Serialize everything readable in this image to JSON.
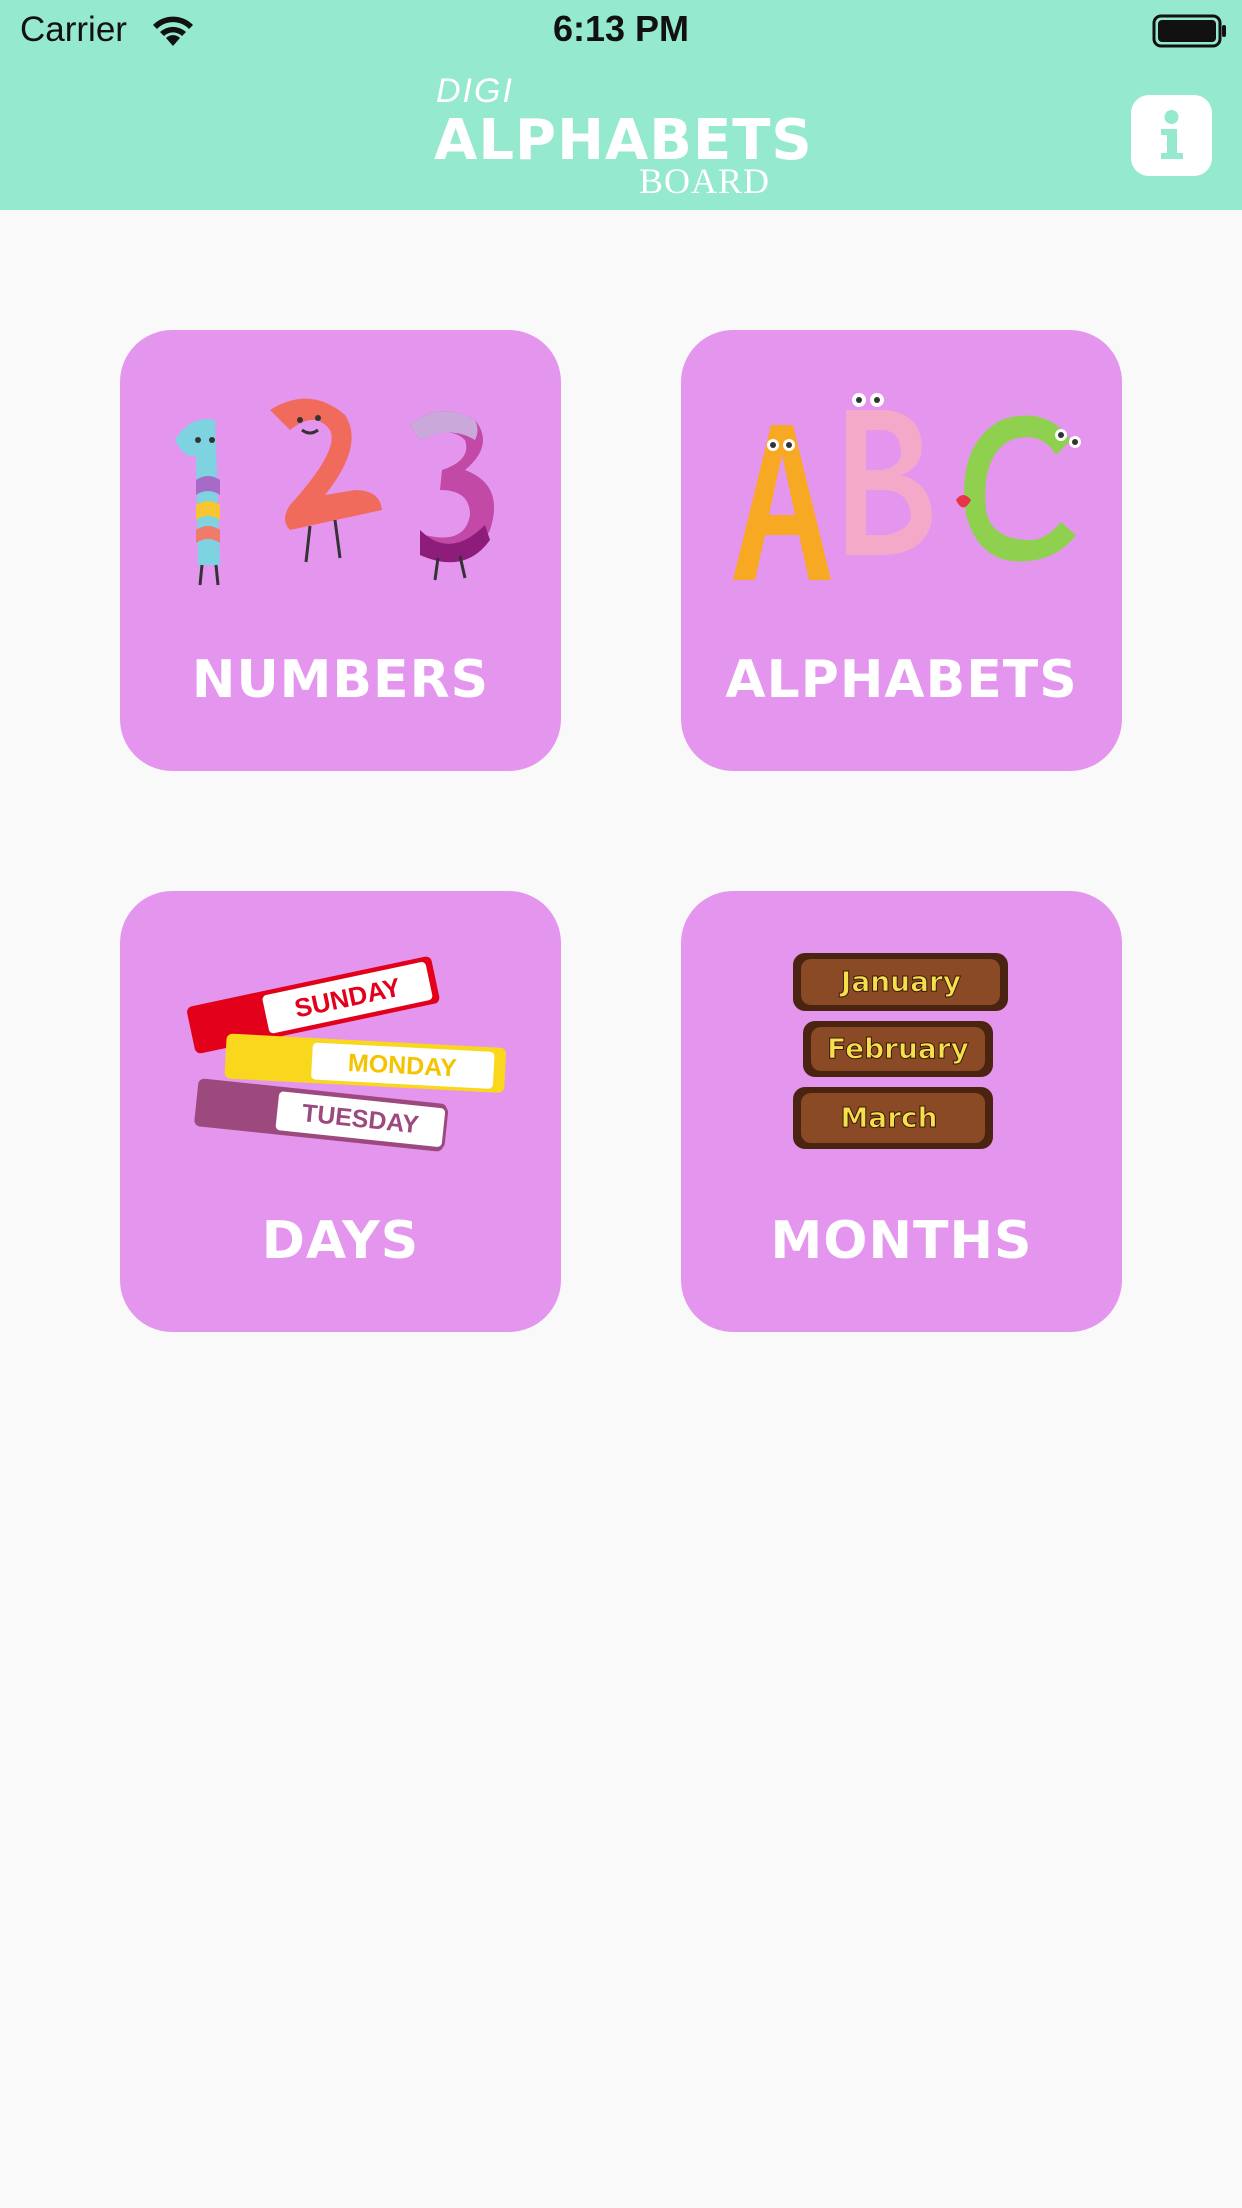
{
  "status_bar": {
    "carrier": "Carrier",
    "time": "6:13 PM"
  },
  "header": {
    "logo_line1": "DIGI",
    "logo_line2": "ALPHABETS",
    "logo_line3": "BOARD",
    "info_icon": "info-icon"
  },
  "tiles": [
    {
      "label": "NUMBERS",
      "art_text": "123"
    },
    {
      "label": "ALPHABETS",
      "art_text": "ABC"
    },
    {
      "label": "DAYS",
      "art_items": [
        "SUNDAY",
        "MONDAY",
        "TUESDAY"
      ]
    },
    {
      "label": "MONTHS",
      "art_items": [
        "January",
        "February",
        "March"
      ]
    }
  ],
  "colors": {
    "header_bg": "#95E9CE",
    "tile_bg": "#E496EF",
    "page_bg": "#F9F9F9"
  }
}
